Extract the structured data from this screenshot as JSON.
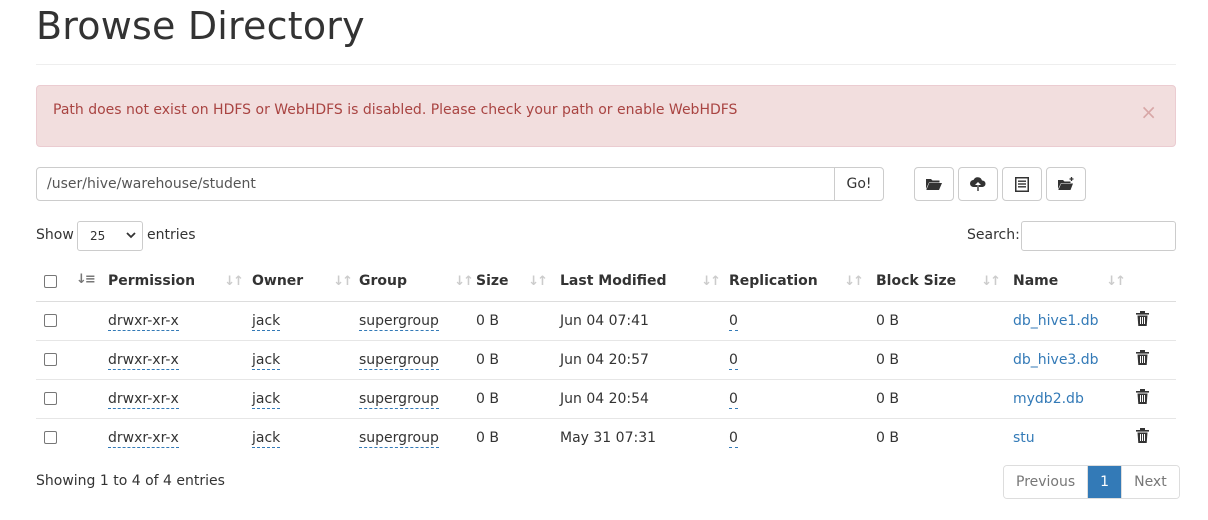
{
  "page": {
    "title": "Browse Directory"
  },
  "alert": {
    "message": "Path does not exist on HDFS or WebHDFS is disabled. Please check your path or enable WebHDFS",
    "close": "×"
  },
  "toolbar": {
    "path_value": "/user/hive/warehouse/student",
    "go_label": "Go!",
    "icons": [
      "folder-open-icon",
      "cloud-upload-icon",
      "list-icon",
      "folder-new-icon"
    ]
  },
  "length": {
    "show_label": "Show",
    "selected": "25",
    "entries_label": "entries"
  },
  "search": {
    "label": "Search:",
    "value": ""
  },
  "table": {
    "columns": [
      "Permission",
      "Owner",
      "Group",
      "Size",
      "Last Modified",
      "Replication",
      "Block Size",
      "Name"
    ],
    "rows": [
      {
        "permission": "drwxr-xr-x",
        "owner": "jack",
        "group": "supergroup",
        "size": "0 B",
        "modified": "Jun 04 07:41",
        "replication": "0",
        "block_size": "0 B",
        "name": "db_hive1.db"
      },
      {
        "permission": "drwxr-xr-x",
        "owner": "jack",
        "group": "supergroup",
        "size": "0 B",
        "modified": "Jun 04 20:57",
        "replication": "0",
        "block_size": "0 B",
        "name": "db_hive3.db"
      },
      {
        "permission": "drwxr-xr-x",
        "owner": "jack",
        "group": "supergroup",
        "size": "0 B",
        "modified": "Jun 04 20:54",
        "replication": "0",
        "block_size": "0 B",
        "name": "mydb2.db"
      },
      {
        "permission": "drwxr-xr-x",
        "owner": "jack",
        "group": "supergroup",
        "size": "0 B",
        "modified": "May 31 07:31",
        "replication": "0",
        "block_size": "0 B",
        "name": "stu"
      }
    ]
  },
  "footer": {
    "info": "Showing 1 to 4 of 4 entries",
    "previous": "Previous",
    "page": "1",
    "next": "Next"
  },
  "colors": {
    "link": "#337ab7",
    "alert_bg": "#f2dede",
    "alert_text": "#a94442",
    "active_page": "#337ab7"
  }
}
